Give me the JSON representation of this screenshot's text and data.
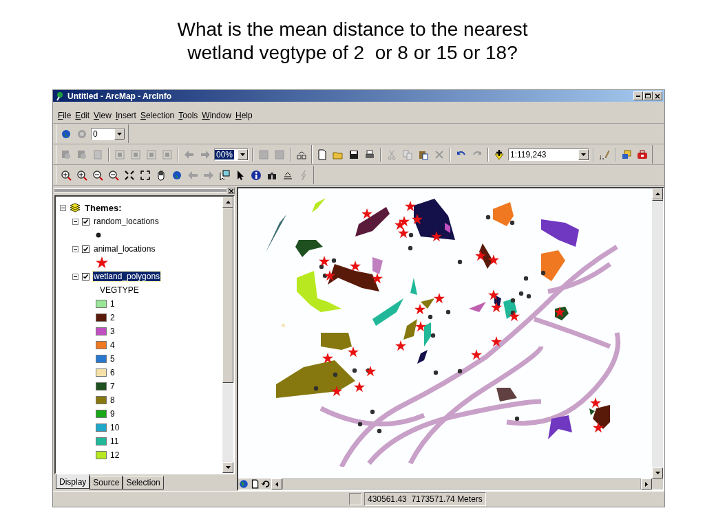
{
  "slide": {
    "title_lines": [
      "What is the mean distance to the nearest",
      "wetland vegtype of 2  or 8 or 15 or 18?"
    ]
  },
  "window": {
    "title": "Untitled - ArcMap - ArcInfo"
  },
  "menu": [
    "File",
    "Edit",
    "View",
    "Insert",
    "Selection",
    "Tools",
    "Window",
    "Help"
  ],
  "toolbar_rotate": {
    "angle": "0"
  },
  "toolbar_layout": {
    "zoom": "00%"
  },
  "toolbar_standard": {
    "scale": "1:119,243"
  },
  "toc": {
    "tree": {
      "label": "Themes:",
      "expanded": true,
      "children": [
        {
          "label": "random_locations",
          "checked": true,
          "expanded": true,
          "selected": false,
          "symbol": {
            "kind": "dot"
          }
        },
        {
          "label": "animal_locations",
          "checked": true,
          "expanded": true,
          "selected": false,
          "symbol": {
            "kind": "star"
          }
        },
        {
          "label": "wetland_polygons",
          "checked": true,
          "expanded": true,
          "selected": true,
          "legend": {
            "field": "VEGTYPE",
            "classes": [
              {
                "label": "1",
                "color": "#99e699"
              },
              {
                "label": "2",
                "color": "#5a1a0a"
              },
              {
                "label": "3",
                "color": "#c050c0"
              },
              {
                "label": "4",
                "color": "#f07820"
              },
              {
                "label": "5",
                "color": "#2878d0"
              },
              {
                "label": "6",
                "color": "#f5e0a8"
              },
              {
                "label": "7",
                "color": "#1e5020"
              },
              {
                "label": "8",
                "color": "#86780f"
              },
              {
                "label": "9",
                "color": "#18a818"
              },
              {
                "label": "10",
                "color": "#20a8c8"
              },
              {
                "label": "11",
                "color": "#20b898"
              },
              {
                "label": "12",
                "color": "#b8e820"
              }
            ]
          }
        }
      ]
    },
    "tabs": [
      {
        "label": "Display",
        "selected": true
      },
      {
        "label": "Source",
        "selected": false
      },
      {
        "label": "Selection",
        "selected": false
      }
    ]
  },
  "status_bar": {
    "coordinates": "430561.43  7173571.74 Meters"
  }
}
